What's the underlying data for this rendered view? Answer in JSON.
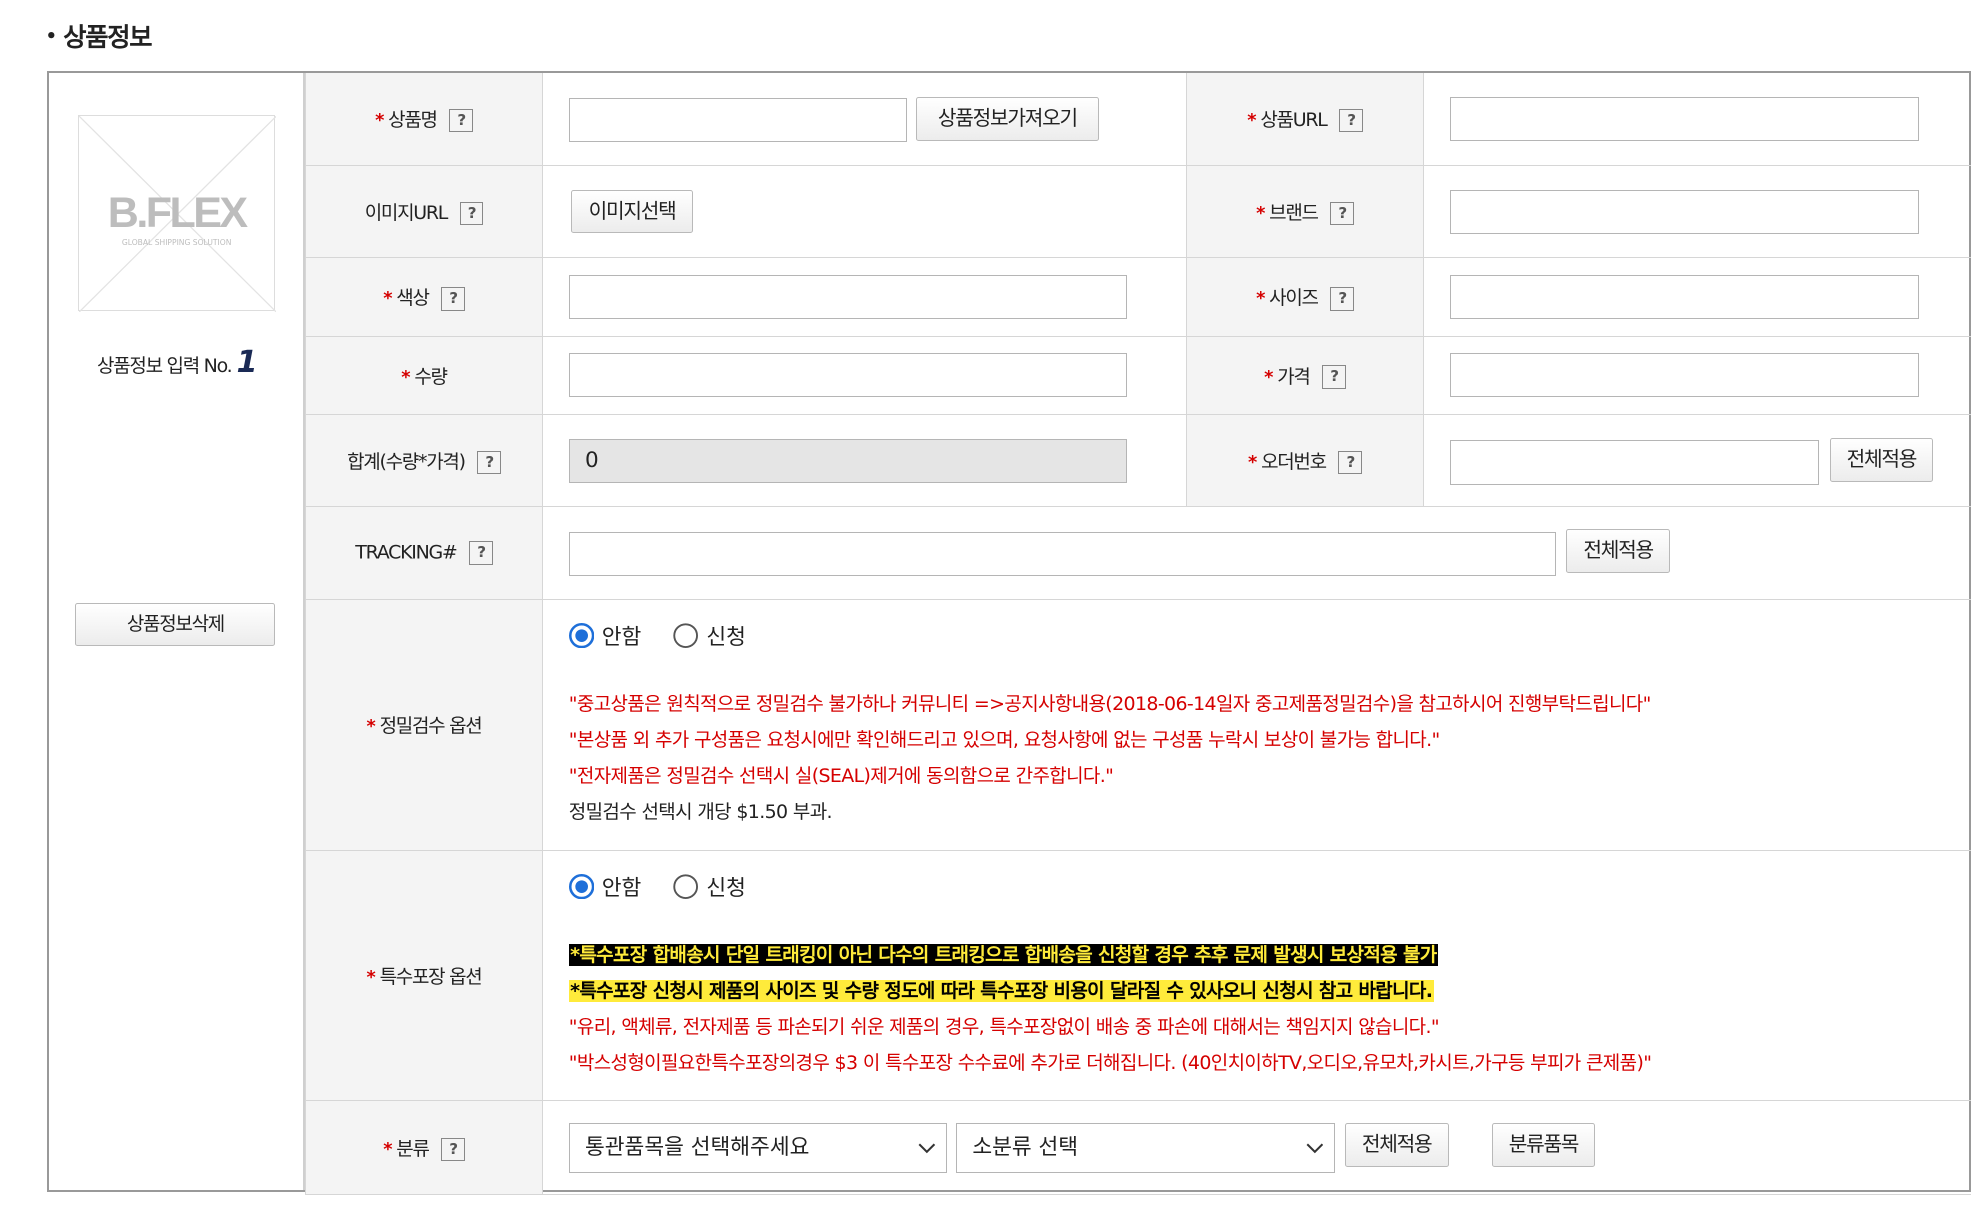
{
  "section": {
    "title": "상품정보"
  },
  "left": {
    "logo_text": "B.FLEX",
    "logo_sub": "GLOBAL SHIPPING SOLUTION",
    "entry_label": "상품정보 입력 No.",
    "entry_number": "1",
    "delete_button": "상품정보삭제"
  },
  "help_glyph": "?",
  "required_mark": "*",
  "fields": {
    "product_name": {
      "label": "상품명",
      "button": "상품정보가져오기",
      "value": ""
    },
    "product_url": {
      "label": "상품URL",
      "value": ""
    },
    "image_url": {
      "label": "이미지URL",
      "button": "이미지선택"
    },
    "brand": {
      "label": "브랜드",
      "value": ""
    },
    "color": {
      "label": "색상",
      "value": ""
    },
    "size": {
      "label": "사이즈",
      "value": ""
    },
    "quantity": {
      "label": "수량",
      "value": ""
    },
    "price": {
      "label": "가격",
      "value": ""
    },
    "total": {
      "label": "합계(수량*가격)",
      "value": "0"
    },
    "order_number": {
      "label": "오더번호",
      "button": "전체적용",
      "value": ""
    },
    "tracking": {
      "label": "TRACKING#",
      "button": "전체적용",
      "value": ""
    }
  },
  "inspection": {
    "label": "정밀검수 옵션",
    "options": [
      "안함",
      "신청"
    ],
    "selected": "안함",
    "notes": [
      "\"중고상품은 원칙적으로 정밀검수 불가하나 커뮤니티 =>공지사항내용(2018-06-14일자 중고제품정밀검수)을 참고하시어 진행부탁드립니다\"",
      "\"본상품 외 추가 구성품은 요청시에만 확인해드리고 있으며, 요청사항에 없는 구성품 누락시 보상이 불가능 합니다.\"",
      "\"전자제품은 정밀검수 선택시 실(SEAL)제거에 동의함으로 간주합니다.\""
    ],
    "fee_note": "정밀검수 선택시 개당 $1.50 부과."
  },
  "packaging": {
    "label": "특수포장 옵션",
    "options": [
      "안함",
      "신청"
    ],
    "selected": "안함",
    "highlight_black": "*특수포장 합배송시 단일 트래킹이 아닌 다수의 트래킹으로 합배송을 신청할 경우 추후 문제 발생시 보상적용 불가",
    "highlight_yellow": "*특수포장 신청시 제품의 사이즈 및 수량 정도에 따라 특수포장 비용이 달라질 수 있사오니 신청시 참고 바랍니다.",
    "notes": [
      "\"유리, 액체류, 전자제품 등 파손되기 쉬운 제품의 경우, 특수포장없이 배송 중 파손에 대해서는 책임지지 않습니다.\"",
      "\"박스성형이필요한특수포장의경우 $3 이 특수포장 수수료에 추가로 더해집니다. (40인치이하TV,오디오,유모차,카시트,가구등 부피가 큰제품)\""
    ]
  },
  "category": {
    "label": "분류",
    "select_main": "통관품목을 선택해주세요",
    "select_sub": "소분류 선택",
    "apply_button": "전체적용",
    "items_button": "분류품목"
  },
  "colors": {
    "required": "#d50000",
    "note_red": "#d50000",
    "highlight_yellow": "#ffeb3b",
    "radio_blue": "#1e6fd9"
  }
}
